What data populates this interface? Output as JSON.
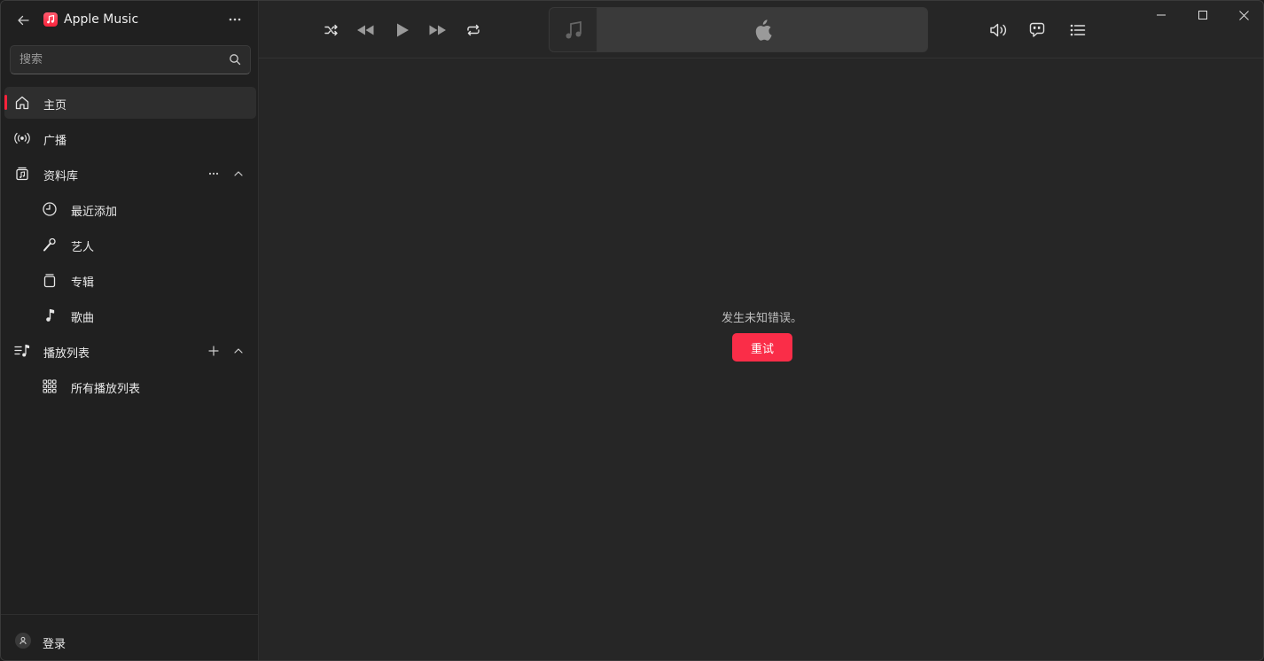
{
  "app": {
    "title": "Apple Music"
  },
  "search": {
    "placeholder": "搜索"
  },
  "nav": {
    "home": "主页",
    "radio": "广播",
    "library": "资料库",
    "recently_added": "最近添加",
    "artists": "艺人",
    "albums": "专辑",
    "songs": "歌曲",
    "playlists": "播放列表",
    "all_playlists": "所有播放列表"
  },
  "account": {
    "signin": "登录"
  },
  "main": {
    "error_message": "发生未知错误。",
    "retry_label": "重试"
  },
  "colors": {
    "accent": "#fa2d48",
    "background": "#262626",
    "sidebar": "#202020"
  }
}
